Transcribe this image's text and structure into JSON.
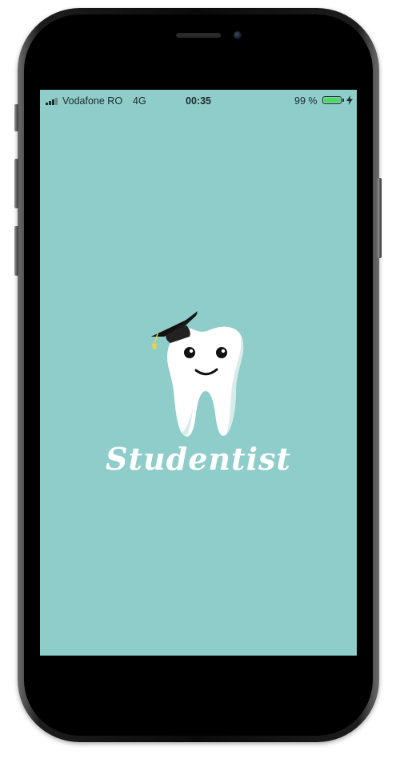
{
  "status_bar": {
    "carrier": "Vodafone RO",
    "network": "4G",
    "time": "00:35",
    "battery_percent": "99 %",
    "battery_level": 0.99,
    "icons": [
      "signal-icon",
      "battery-icon",
      "charging-icon"
    ]
  },
  "splash": {
    "app_name": "Studentist",
    "logo_icon": "tooth-graduation-cap-icon",
    "background_color": "#8ecdca",
    "text_color": "#ffffff"
  }
}
